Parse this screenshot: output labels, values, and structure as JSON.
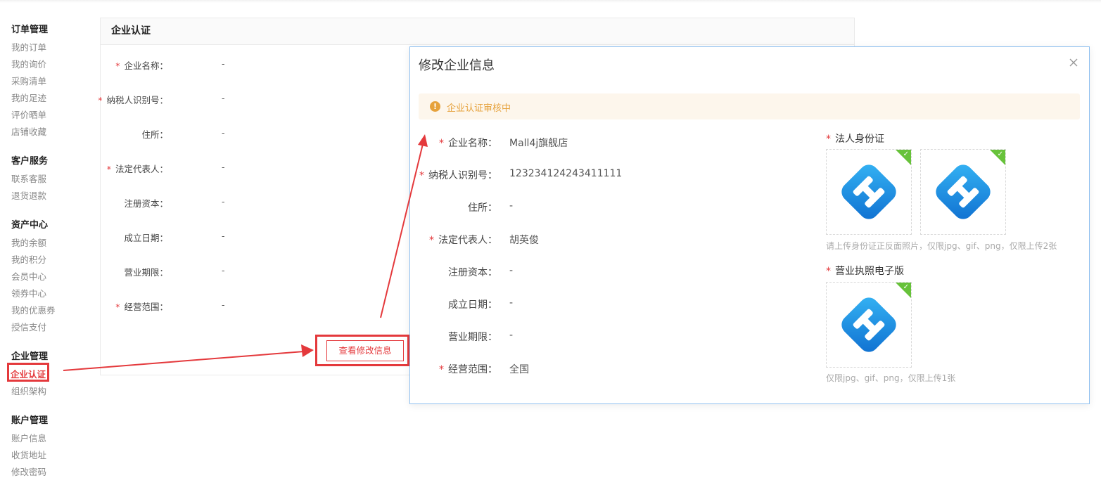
{
  "sidebar": {
    "groups": [
      {
        "title": "订单管理",
        "items": [
          "我的订单",
          "我的询价",
          "采购清单",
          "我的足迹",
          "评价晒单",
          "店铺收藏"
        ]
      },
      {
        "title": "客户服务",
        "items": [
          "联系客服",
          "退货退款"
        ]
      },
      {
        "title": "资产中心",
        "items": [
          "我的余额",
          "我的积分",
          "会员中心",
          "领券中心",
          "我的优惠券",
          "授信支付"
        ]
      },
      {
        "title": "企业管理",
        "items": [
          "企业认证",
          "组织架构"
        ]
      },
      {
        "title": "账户管理",
        "items": [
          "账户信息",
          "收货地址",
          "修改密码"
        ]
      }
    ],
    "active_item": "企业认证"
  },
  "card": {
    "title": "企业认证",
    "required_mark": "*",
    "fields": [
      {
        "label": "企业名称：",
        "value": "-",
        "required": true
      },
      {
        "label": "纳税人识别号：",
        "value": "-",
        "required": true
      },
      {
        "label": "住所：",
        "value": "-",
        "required": false
      },
      {
        "label": "法定代表人：",
        "value": "-",
        "required": true
      },
      {
        "label": "注册资本：",
        "value": "-",
        "required": false
      },
      {
        "label": "成立日期：",
        "value": "-",
        "required": false
      },
      {
        "label": "营业期限：",
        "value": "-",
        "required": false
      },
      {
        "label": "经营范围：",
        "value": "-",
        "required": true
      }
    ],
    "view_button": "查看修改信息"
  },
  "modal": {
    "title": "修改企业信息",
    "close_icon": "close-icon",
    "alert": "企业认证审核中",
    "fields": [
      {
        "label": "企业名称：",
        "value": "Mall4j旗舰店",
        "required": true
      },
      {
        "label": "纳税人识别号：",
        "value": "123234124243411111",
        "required": true
      },
      {
        "label": "住所：",
        "value": "-",
        "required": false
      },
      {
        "label": "法定代表人：",
        "value": "胡英俊",
        "required": true
      },
      {
        "label": "注册资本：",
        "value": "-",
        "required": false
      },
      {
        "label": "成立日期：",
        "value": "-",
        "required": false
      },
      {
        "label": "营业期限：",
        "value": "-",
        "required": false
      },
      {
        "label": "经营范围：",
        "value": "全国",
        "required": true
      }
    ],
    "id_card": {
      "title": "法人身份证",
      "hint": "请上传身份证正反面照片，仅限jpg、gif、png，仅限上传2张"
    },
    "license": {
      "title": "营业执照电子版",
      "hint": "仅限jpg、gif、png，仅限上传1张"
    }
  },
  "colors": {
    "accent": "#e4393c",
    "warning": "#e6a23c",
    "success": "#67c23a",
    "logo_blue": "#1a8fe3"
  }
}
